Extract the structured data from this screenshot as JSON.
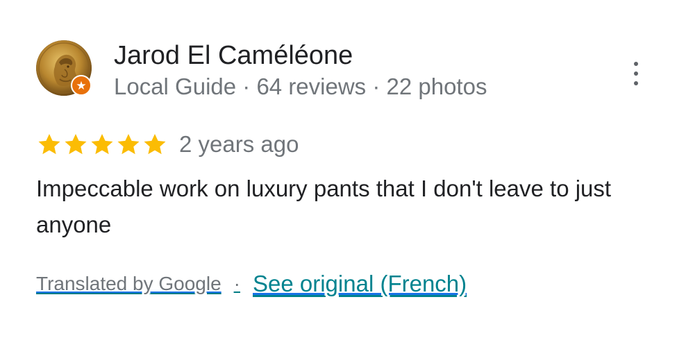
{
  "review": {
    "author": {
      "name": "Jarod El Caméléone",
      "meta": "Local Guide · 64 reviews · 22 photos",
      "badge_icon": "star-icon",
      "avatar": "roman-coin-portrait"
    },
    "rating": {
      "stars": 5,
      "max_stars": 5,
      "star_color": "#fbbc04"
    },
    "date": "2 years ago",
    "text": "Impeccable work on luxury pants that I don't leave to just anyone",
    "translation": {
      "translated_by": "Translated by Google",
      "separator": "·",
      "see_original": "See original (French)"
    },
    "menu_icon": "more-vert-icon"
  },
  "colors": {
    "primary_text": "#202124",
    "secondary_text": "#70757a",
    "link": "#00838f",
    "guide_badge": "#e8710a"
  }
}
